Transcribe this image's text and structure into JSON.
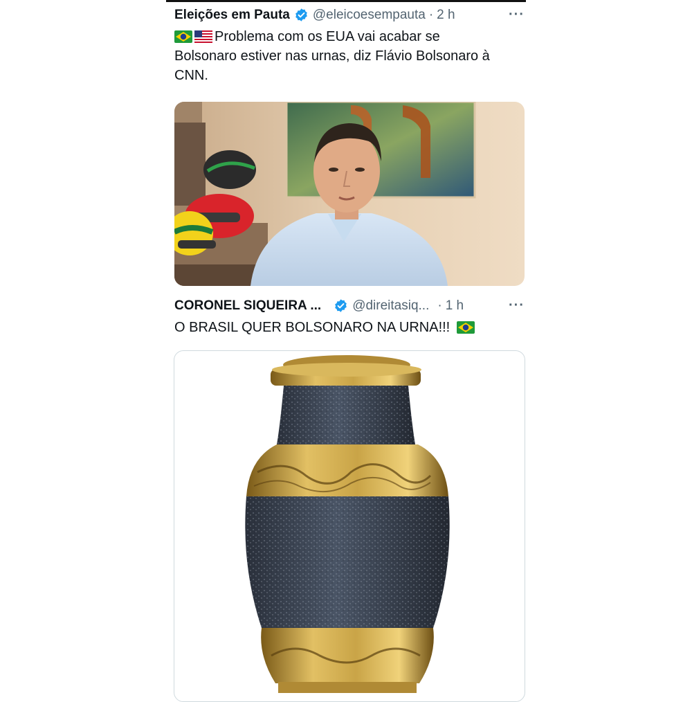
{
  "tweet1": {
    "name": "Eleições em Pauta",
    "handle": "@eleicoesempauta",
    "separator": "·",
    "time": "2 h",
    "more": "···",
    "flags": [
      "brazil-flag",
      "usa-flag"
    ],
    "text_line1": "Problema com os EUA vai acabar se",
    "text_line2": "Bolsonaro estiver nas urnas, diz Flávio Bolsonaro à",
    "text_line3": "CNN.",
    "media": "video-frame-man-speaking"
  },
  "tweet2": {
    "name": "CORONEL SIQUEIRA ...",
    "handle": "@direitasiq...",
    "separator": "·",
    "time": "1 h",
    "more": "···",
    "text": "O BRASIL QUER BOLSONARO NA URNA!!!",
    "flags": [
      "brazil-flag"
    ],
    "media": "funeral-urn-photo"
  },
  "colors": {
    "verified": "#1d9bf0",
    "secondary_text": "#536471",
    "primary_text": "#0f1419",
    "urn_body": "#3b4453",
    "urn_gold": "#c9a447"
  }
}
